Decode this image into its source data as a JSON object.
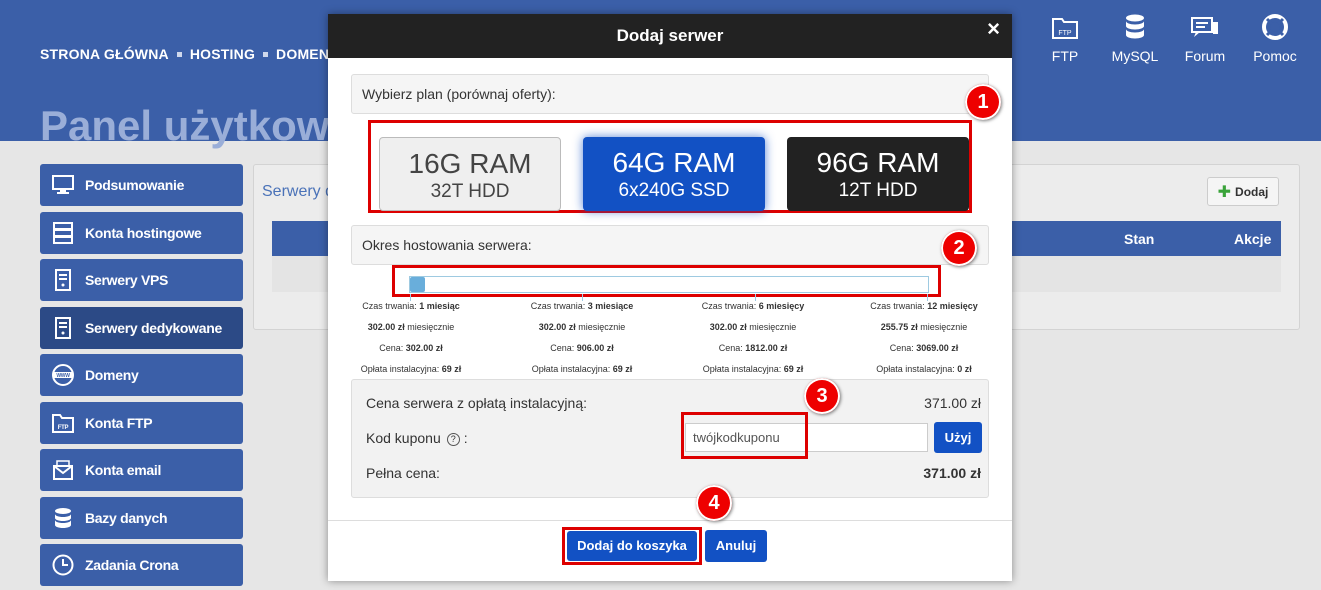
{
  "topnav": {
    "items": [
      "STRONA GŁÓWNA",
      "HOSTING",
      "DOMENY"
    ]
  },
  "page_title": "Panel użytkow",
  "right_nav": [
    {
      "label": "FTP",
      "icon": "ftp-folder-icon"
    },
    {
      "label": "MySQL",
      "icon": "database-icon"
    },
    {
      "label": "Forum",
      "icon": "forum-chat-icon"
    },
    {
      "label": "Pomoc",
      "icon": "lifebuoy-icon"
    }
  ],
  "sidebar": {
    "items": [
      {
        "label": "Podsumowanie",
        "icon": "monitor-icon"
      },
      {
        "label": "Konta hostingowe",
        "icon": "server-rack-icon"
      },
      {
        "label": "Serwery VPS",
        "icon": "server-icon"
      },
      {
        "label": "Serwery dedykowane",
        "icon": "server-icon"
      },
      {
        "label": "Domeny",
        "icon": "globe-www-icon"
      },
      {
        "label": "Konta FTP",
        "icon": "ftp-folder-icon"
      },
      {
        "label": "Konta email",
        "icon": "email-icon"
      },
      {
        "label": "Bazy danych",
        "icon": "database-icon"
      },
      {
        "label": "Zadania Crona",
        "icon": "clock-icon"
      }
    ]
  },
  "content": {
    "title": "Serwery d",
    "add_button": "Dodaj",
    "columns": {
      "stan": "Stan",
      "akcje": "Akcje"
    }
  },
  "modal": {
    "title": "Dodaj serwer",
    "close": "×",
    "plan_label": "Wybierz plan (porównaj oferty):",
    "plans": [
      {
        "ram": "16G RAM",
        "disk": "32T HDD"
      },
      {
        "ram": "64G RAM",
        "disk": "6x240G SSD"
      },
      {
        "ram": "96G RAM",
        "disk": "12T HDD"
      }
    ],
    "period_label": "Okres hostowania serwera:",
    "periods": [
      {
        "duration_label": "Czas trwania:",
        "duration": "1 miesiąc",
        "monthly_value": "302.00 zł",
        "monthly_suffix": "miesięcznie",
        "price_label": "Cena:",
        "price": "302.00 zł",
        "fee_label": "Opłata instalacyjna:",
        "fee": "69 zł"
      },
      {
        "duration_label": "Czas trwania:",
        "duration": "3 miesiące",
        "monthly_value": "302.00 zł",
        "monthly_suffix": "miesięcznie",
        "price_label": "Cena:",
        "price": "906.00 zł",
        "fee_label": "Opłata instalacyjna:",
        "fee": "69 zł"
      },
      {
        "duration_label": "Czas trwania:",
        "duration": "6 miesięcy",
        "monthly_value": "302.00 zł",
        "monthly_suffix": "miesięcznie",
        "price_label": "Cena:",
        "price": "1812.00 zł",
        "fee_label": "Opłata instalacyjna:",
        "fee": "69 zł"
      },
      {
        "duration_label": "Czas trwania:",
        "duration": "12 miesięcy",
        "monthly_value": "255.75 zł",
        "monthly_suffix": "miesięcznie",
        "price_label": "Cena:",
        "price": "3069.00 zł",
        "fee_label": "Opłata instalacyjna:",
        "fee": "0 zł"
      }
    ],
    "price_with_fee_label": "Cena serwera z opłatą instalacyjną:",
    "price_with_fee_value": "371.00 zł",
    "coupon_label": "Kod kuponu",
    "coupon_help": "?",
    "coupon_colon": ":",
    "coupon_value": "twójkodkuponu",
    "use_button": "Użyj",
    "full_price_label": "Pełna cena:",
    "full_price_value": "371.00 zł",
    "add_to_cart": "Dodaj do koszyka",
    "cancel": "Anuluj"
  },
  "annotations": {
    "b1": "1",
    "b2": "2",
    "b3": "3",
    "b4": "4"
  }
}
